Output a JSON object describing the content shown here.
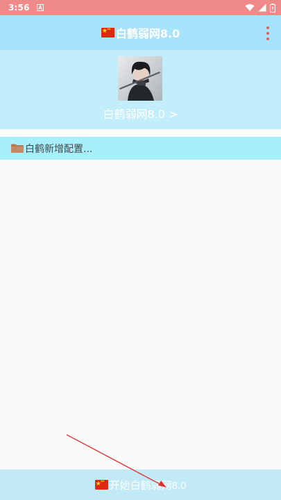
{
  "status_bar": {
    "time": "3:56",
    "notification_icon": "a-notification-icon",
    "icons": [
      "wifi-icon",
      "signal-icon",
      "battery-icon"
    ]
  },
  "app_bar": {
    "title": "白鹤弱网8.0",
    "flag_icon": "china-flag-icon",
    "menu_icon": "more-vert-icon"
  },
  "profile": {
    "name": "白鹤弱网8.0 >",
    "avatar_icon": "avatar-image"
  },
  "config": {
    "label": "白鹤新增配置...",
    "icon": "folder-icon"
  },
  "start_button": {
    "label": "开始白鹤弱网8.0",
    "flag_icon": "china-flag-icon"
  },
  "colors": {
    "status_bar": "#f08a8a",
    "app_bar": "#a7e4fb",
    "header_card": "#c2eefc",
    "config_row": "#a7f0fb",
    "start_button": "#c2eaf6",
    "annotation_arrow": "#e03030"
  }
}
